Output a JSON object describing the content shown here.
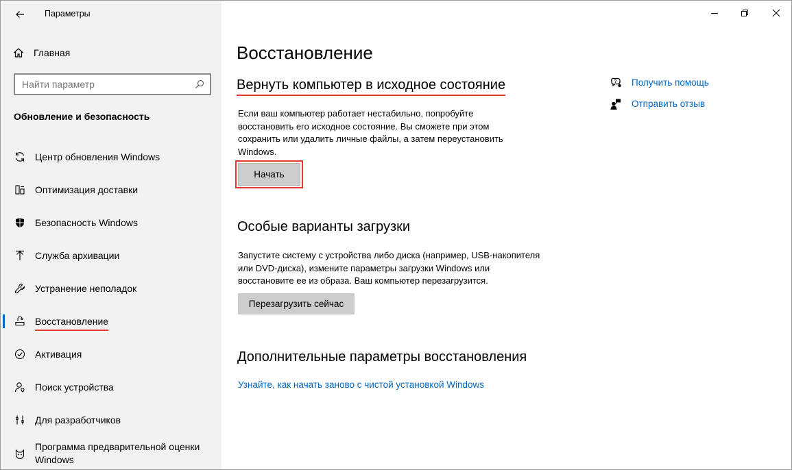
{
  "window": {
    "title": "Параметры"
  },
  "sidebar": {
    "home_label": "Главная",
    "search_placeholder": "Найти параметр",
    "section_title": "Обновление и безопасность",
    "items": [
      {
        "label": "Центр обновления Windows",
        "icon": "sync-icon"
      },
      {
        "label": "Оптимизация доставки",
        "icon": "delivery-optimization-icon"
      },
      {
        "label": "Безопасность Windows",
        "icon": "shield-icon"
      },
      {
        "label": "Служба архивации",
        "icon": "backup-arrow-icon"
      },
      {
        "label": "Устранение неполадок",
        "icon": "wrench-icon"
      },
      {
        "label": "Восстановление",
        "icon": "recovery-icon",
        "active": true
      },
      {
        "label": "Активация",
        "icon": "check-circle-icon"
      },
      {
        "label": "Поиск устройства",
        "icon": "person-location-icon"
      },
      {
        "label": "Для разработчиков",
        "icon": "developer-tools-icon"
      },
      {
        "label": "Программа предварительной оценки Windows",
        "icon": "cat-icon"
      }
    ]
  },
  "main": {
    "page_title": "Восстановление",
    "reset": {
      "heading": "Вернуть компьютер в исходное состояние",
      "text": "Если ваш компьютер работает нестабильно, попробуйте восстановить его исходное состояние. Вы сможете при этом сохранить или удалить личные файлы, а затем переустановить Windows.",
      "button": "Начать"
    },
    "advanced_startup": {
      "heading": "Особые варианты загрузки",
      "text": "Запустите систему с устройства либо диска (например, USB-накопителя или DVD-диска), измените параметры загрузки Windows или восстановите ее из образа. Ваш компьютер перезагрузится.",
      "button": "Перезагрузить сейчас"
    },
    "more_options": {
      "heading": "Дополнительные параметры восстановления",
      "link": "Узнайте, как начать заново с чистой установкой Windows"
    },
    "help_links": {
      "get_help": "Получить помощь",
      "feedback": "Отправить отзыв"
    }
  },
  "colors": {
    "accent": "#0067c0",
    "highlight": "#e53935",
    "sidebar_bg": "#f2f2f2"
  }
}
